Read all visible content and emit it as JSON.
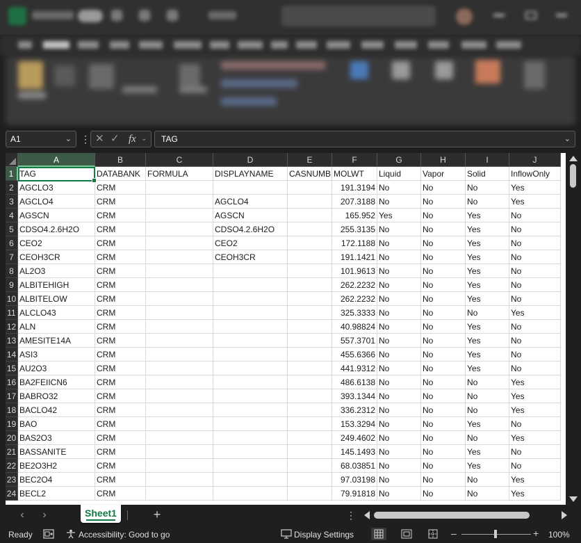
{
  "namebox": {
    "value": "A1"
  },
  "formula": {
    "fx_label": "fx",
    "value": "TAG"
  },
  "columns": [
    "A",
    "B",
    "C",
    "D",
    "E",
    "F",
    "G",
    "H",
    "I",
    "J"
  ],
  "rows": [
    {
      "n": "1",
      "cells": [
        "TAG",
        "DATABANK",
        "FORMULA",
        "DISPLAYNAME",
        "CASNUMB",
        "MOLWT",
        "Liquid",
        "Vapor",
        "Solid",
        "InflowOnly"
      ]
    },
    {
      "n": "2",
      "cells": [
        "AGCLO3",
        "CRM",
        "",
        "",
        "",
        "191.3194",
        "No",
        "No",
        "No",
        "Yes"
      ]
    },
    {
      "n": "3",
      "cells": [
        "AGCLO4",
        "CRM",
        "",
        "AGCLO4",
        "",
        "207.3188",
        "No",
        "No",
        "No",
        "Yes"
      ]
    },
    {
      "n": "4",
      "cells": [
        "AGSCN",
        "CRM",
        "",
        "AGSCN",
        "",
        "165.952",
        "Yes",
        "No",
        "Yes",
        "No"
      ]
    },
    {
      "n": "5",
      "cells": [
        "CDSO4.2.6H2O",
        "CRM",
        "",
        "CDSO4.2.6H2O",
        "",
        "255.3135",
        "No",
        "No",
        "Yes",
        "No"
      ]
    },
    {
      "n": "6",
      "cells": [
        "CEO2",
        "CRM",
        "",
        "CEO2",
        "",
        "172.1188",
        "No",
        "No",
        "Yes",
        "No"
      ]
    },
    {
      "n": "7",
      "cells": [
        "CEOH3CR",
        "CRM",
        "",
        "CEOH3CR",
        "",
        "191.1421",
        "No",
        "No",
        "Yes",
        "No"
      ]
    },
    {
      "n": "8",
      "cells": [
        "AL2O3",
        "CRM",
        "",
        "",
        "",
        "101.9613",
        "No",
        "No",
        "Yes",
        "No"
      ]
    },
    {
      "n": "9",
      "cells": [
        "ALBITEHIGH",
        "CRM",
        "",
        "",
        "",
        "262.2232",
        "No",
        "No",
        "Yes",
        "No"
      ]
    },
    {
      "n": "10",
      "cells": [
        "ALBITELOW",
        "CRM",
        "",
        "",
        "",
        "262.2232",
        "No",
        "No",
        "Yes",
        "No"
      ]
    },
    {
      "n": "11",
      "cells": [
        "ALCLO43",
        "CRM",
        "",
        "",
        "",
        "325.3333",
        "No",
        "No",
        "No",
        "Yes"
      ]
    },
    {
      "n": "12",
      "cells": [
        "ALN",
        "CRM",
        "",
        "",
        "",
        "40.98824",
        "No",
        "No",
        "Yes",
        "No"
      ]
    },
    {
      "n": "13",
      "cells": [
        "AMESITE14A",
        "CRM",
        "",
        "",
        "",
        "557.3701",
        "No",
        "No",
        "Yes",
        "No"
      ]
    },
    {
      "n": "14",
      "cells": [
        "ASI3",
        "CRM",
        "",
        "",
        "",
        "455.6366",
        "No",
        "No",
        "Yes",
        "No"
      ]
    },
    {
      "n": "15",
      "cells": [
        "AU2O3",
        "CRM",
        "",
        "",
        "",
        "441.9312",
        "No",
        "No",
        "Yes",
        "No"
      ]
    },
    {
      "n": "16",
      "cells": [
        "BA2FEIICN6",
        "CRM",
        "",
        "",
        "",
        "486.6138",
        "No",
        "No",
        "No",
        "Yes"
      ]
    },
    {
      "n": "17",
      "cells": [
        "BABRO32",
        "CRM",
        "",
        "",
        "",
        "393.1344",
        "No",
        "No",
        "No",
        "Yes"
      ]
    },
    {
      "n": "18",
      "cells": [
        "BACLO42",
        "CRM",
        "",
        "",
        "",
        "336.2312",
        "No",
        "No",
        "No",
        "Yes"
      ]
    },
    {
      "n": "19",
      "cells": [
        "BAO",
        "CRM",
        "",
        "",
        "",
        "153.3294",
        "No",
        "No",
        "Yes",
        "No"
      ]
    },
    {
      "n": "20",
      "cells": [
        "BAS2O3",
        "CRM",
        "",
        "",
        "",
        "249.4602",
        "No",
        "No",
        "No",
        "Yes"
      ]
    },
    {
      "n": "21",
      "cells": [
        "BASSANITE",
        "CRM",
        "",
        "",
        "",
        "145.1493",
        "No",
        "No",
        "Yes",
        "No"
      ]
    },
    {
      "n": "22",
      "cells": [
        "BE2O3H2",
        "CRM",
        "",
        "",
        "",
        "68.03851",
        "No",
        "No",
        "Yes",
        "No"
      ]
    },
    {
      "n": "23",
      "cells": [
        "BEC2O4",
        "CRM",
        "",
        "",
        "",
        "97.03198",
        "No",
        "No",
        "No",
        "Yes"
      ]
    },
    {
      "n": "24",
      "cells": [
        "BECL2",
        "CRM",
        "",
        "",
        "",
        "79.91818",
        "No",
        "No",
        "No",
        "Yes"
      ]
    }
  ],
  "sheet_tab": "Sheet1",
  "status": {
    "ready": "Ready",
    "accessibility": "Accessibility: Good to go",
    "display_settings": "Display Settings",
    "zoom": "100%"
  },
  "colors": {
    "accent": "#107c41",
    "chrome": "#1f1f1f",
    "header": "#2d2d2d"
  }
}
